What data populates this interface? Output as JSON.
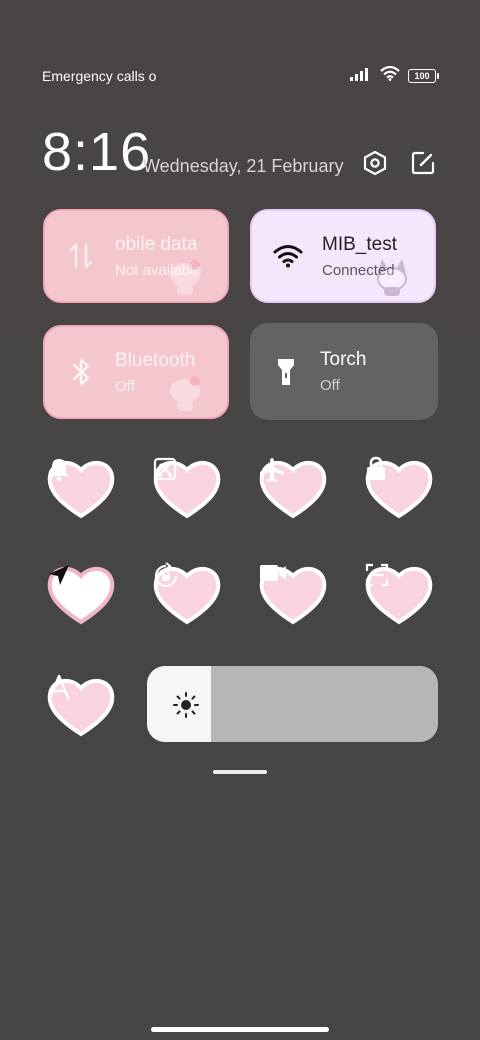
{
  "status": {
    "carrier_text": "Emergency calls o",
    "battery_level": "100"
  },
  "header": {
    "time": "8:16",
    "date": "Wednesday, 21 February"
  },
  "tiles": [
    {
      "title": "obile data",
      "subtitle": "Not available",
      "icon": "mobile-data-icon",
      "state": "off"
    },
    {
      "title": "MIB_test",
      "subtitle": "Connected",
      "icon": "wifi-icon",
      "state": "on"
    },
    {
      "title": "Bluetooth",
      "subtitle": "Off",
      "icon": "bluetooth-icon",
      "state": "off"
    },
    {
      "title": "Torch",
      "subtitle": "Off",
      "icon": "torch-icon",
      "state": "off"
    }
  ],
  "toggles_row1": [
    "bell-icon",
    "screenshot-icon",
    "airplane-icon",
    "lock-icon"
  ],
  "toggles_row2": [
    "location-icon",
    "rotation-lock-icon",
    "screen-record-icon",
    "scanner-icon"
  ],
  "toggles_row3": [
    "font-size-icon"
  ],
  "brightness": {
    "level": 0.22
  },
  "colors": {
    "tile_pink": "#f4c7cf",
    "tile_lavender": "#f5e6fb",
    "tile_gray": "#636363",
    "heart_fill": "#f9d3de",
    "heart_active": "#ffffff"
  }
}
